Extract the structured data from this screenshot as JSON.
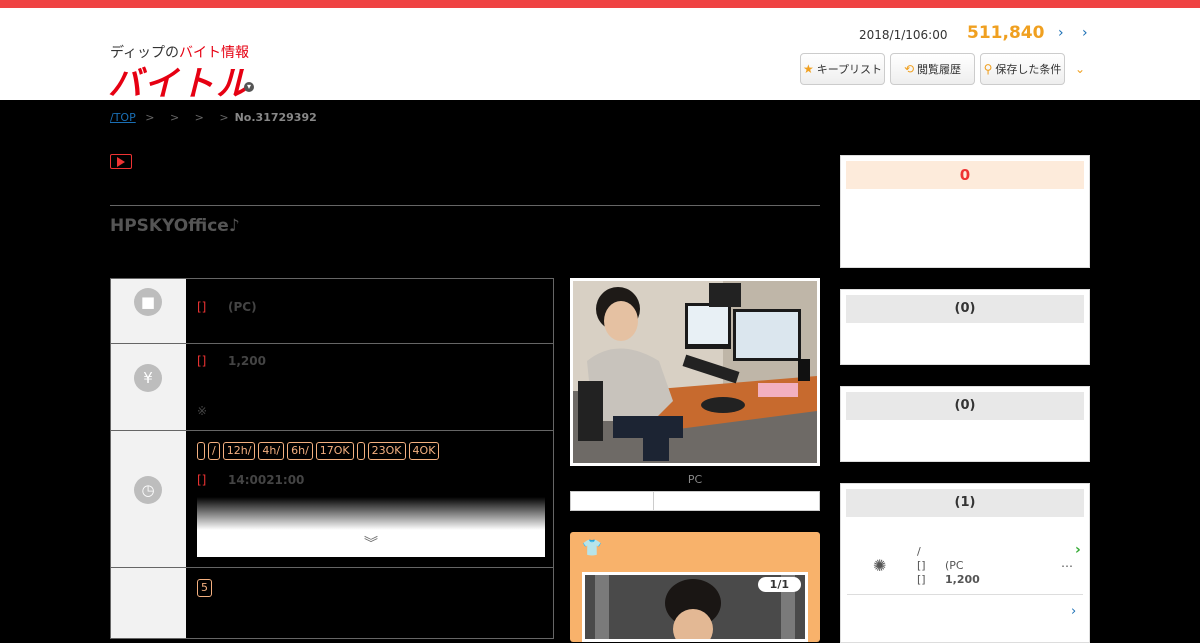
{
  "header": {
    "logo_sub_prefix": "ディップの",
    "logo_sub_red": "バイト情報",
    "logo_main": "バイトル",
    "date": "2018/1/106:00",
    "count": "511,840",
    "arrow1": "›",
    "arrow2": "›",
    "buttons": [
      {
        "icon": "★",
        "label": "キープリスト"
      },
      {
        "icon": "⟲",
        "label": "閲覧履歴"
      },
      {
        "icon": "⚲",
        "label": "保存した条件"
      }
    ],
    "more_chevron": "⌄"
  },
  "breadcrumb": {
    "top": "/TOP",
    "seps": [
      ">",
      ">",
      ">",
      ">"
    ],
    "last": "No.31729392"
  },
  "job": {
    "title": "HPSKYOffice♪",
    "rows": {
      "work": {
        "tag": "[]",
        "text": "(PC)"
      },
      "pay": {
        "tag": "[]",
        "text": "1,200",
        "note": "※"
      },
      "time": {
        "tags": [
          "",
          "/",
          "12h/",
          "4h/",
          "6h/",
          "17OK",
          "",
          "23OK",
          "4OK"
        ],
        "tag": "[]",
        "text": "14:0021:00",
        "more": "︾"
      },
      "place": {
        "tag": "5"
      }
    }
  },
  "photo": {
    "caption": "PC"
  },
  "slide": {
    "pager": "1/1"
  },
  "sidebar": {
    "box1": {
      "title": "0"
    },
    "box2": {
      "title": "(0)"
    },
    "box3": {
      "title": "(0)"
    },
    "box4": {
      "title": "(1)",
      "line1": "/",
      "tag1": "[]",
      "text1": "(PC",
      "tag2": "[]",
      "text2": "1,200",
      "dots": "…"
    }
  }
}
